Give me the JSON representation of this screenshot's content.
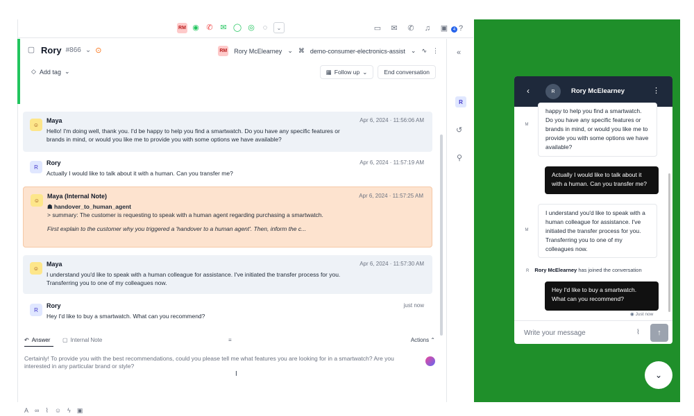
{
  "topbar": {
    "agent_chip": "RM",
    "icons_center": [
      "status-green-icon",
      "phone-icon",
      "mail-icon",
      "chat-icon",
      "whatsapp-icon",
      "globe-icon",
      "chevron-down-icon"
    ],
    "icons_right": [
      "inbox-icon",
      "mail-icon",
      "phone-icon",
      "bell-icon",
      "tray-icon",
      "help-icon"
    ],
    "notification_count": "4"
  },
  "conversation": {
    "contact_name": "Rory",
    "ticket_id": "#866",
    "assignee_chip": "RM",
    "assignee": "Rory McElearney",
    "workspace": "demo-consumer-electronics-assist",
    "add_tag_label": "Add tag",
    "follow_up_label": "Follow up",
    "end_label": "End conversation"
  },
  "messages": [
    {
      "author": "Maya",
      "time": "Apr 6, 2024 · 11:56:06 AM",
      "text": "Hello! I'm doing well, thank you. I'd be happy to help you find a smartwatch. Do you have any specific features or brands in mind, or would you like me to provide you with some options we have available?"
    },
    {
      "author": "Rory",
      "avatar": "R",
      "time": "Apr 6, 2024 · 11:57:19 AM",
      "text": "Actually I would like to talk about it with a human. Can you transfer me?"
    },
    {
      "author": "Maya  (Internal Note)",
      "time": "Apr 6, 2024 · 11:57:25 AM",
      "tool": "handover_to_human_agent",
      "summary": "> summary: The customer is requesting to speak with a human agent regarding purchasing a smartwatch.",
      "instruction": "First explain to the customer why you triggered a 'handover to a human agent'. Then, inform the c..."
    },
    {
      "author": "Maya",
      "time": "Apr 6, 2024 · 11:57:30 AM",
      "text": "I understand you'd like to speak with a human colleague for assistance. I've initiated the transfer process for you. Transferring you to one of my colleagues now."
    },
    {
      "author": "Rory",
      "avatar": "R",
      "time": "just now",
      "text": "Hey I'd like to buy a smartwatch. What can you recommend?"
    }
  ],
  "composer": {
    "tab_answer": "Answer",
    "tab_internal": "Internal Note",
    "actions_label": "Actions",
    "draft": "Certainly! To provide you with the best recommendations, could you please tell me what features you are looking for in a smartwatch? Are you interested in any particular brand or style?"
  },
  "side": {
    "contact_initial": "R"
  },
  "widget": {
    "avatar": "R",
    "name": "Rory McElearney",
    "bot_avatar": "M",
    "bot1": "happy to help you find a smartwatch. Do you have any specific features or brands in mind, or would you like me to provide you with some options we have available?",
    "user1": "Actually I would like to talk about it with a human. Can you transfer me?",
    "bot2": "I understand you'd like to speak with a human colleague for assistance. I've initiated the transfer process for you. Transferring you to one of my colleagues now.",
    "joined_avatar": "R",
    "joined_name": "Rory McElearney",
    "joined_text": "has joined the conversation",
    "user2": "Hey I'd like to buy a smartwatch. What can you recommend?",
    "just_now": "Just now",
    "placeholder": "Write your message"
  },
  "colors": {
    "accent_green": "#22c55e",
    "background_green": "#1f8f2a",
    "note_bg": "#fde3cf"
  }
}
